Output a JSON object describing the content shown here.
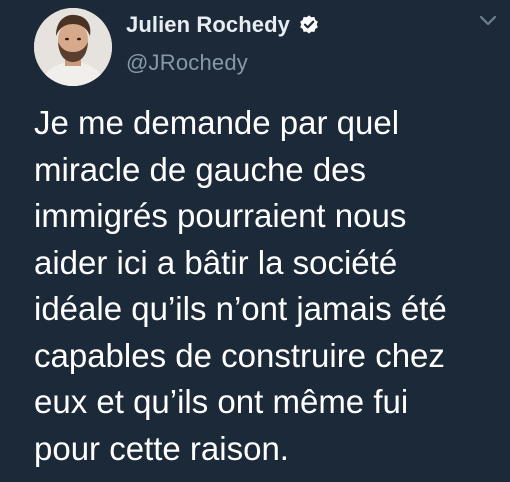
{
  "tweet": {
    "author": {
      "display_name": "Julien Rochedy",
      "handle": "@JRochedy",
      "verified": true,
      "avatar_icon": "user-avatar-photo"
    },
    "menu_icon": "chevron-down-icon",
    "text": "Je me demande par quel\nmiracle de gauche des\nimmigrés pourraient nous\naider ici a bâtir la société\nidéale qu’ils n’ont jamais été\ncapables de construire chez\neux et qu’ils ont même fui\npour cette raison."
  },
  "colors": {
    "background": "#1c2938",
    "text_primary": "#ffffff",
    "text_secondary": "#8899a6",
    "verified_badge": "#ffffff"
  }
}
